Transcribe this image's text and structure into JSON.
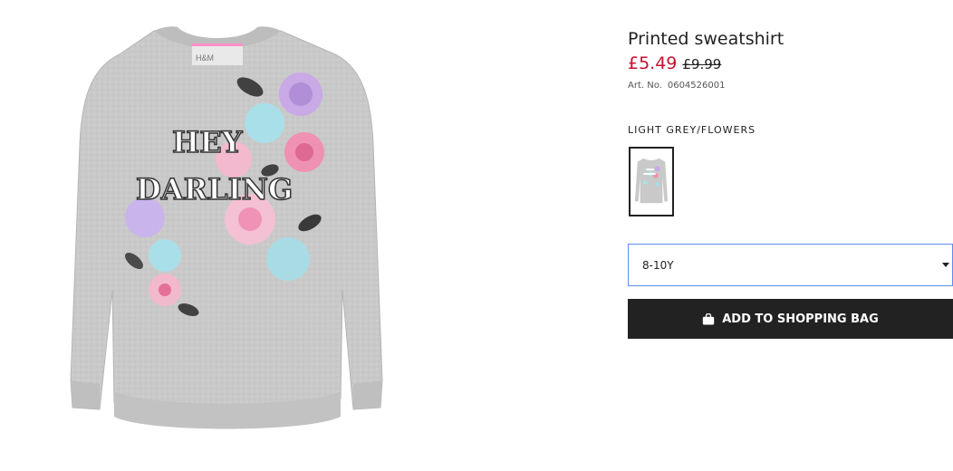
{
  "product": {
    "title": "Printed sweatshirt",
    "price_sale": "£5.49",
    "price_original": "£9.99",
    "art_label": "Art. No.",
    "art_number": "0604526001",
    "image_print_text_line1": "HEY",
    "image_print_text_line2": "DARLING",
    "image_neck_label": "H&M"
  },
  "color": {
    "name": "LIGHT GREY/FLOWERS",
    "selected_swatch": "light-grey-flowers"
  },
  "size_select": {
    "value": "8-10Y"
  },
  "actions": {
    "add_to_bag_label": "ADD TO SHOPPING BAG",
    "add_to_bag_icon": "shopping-bag-icon"
  },
  "colors": {
    "sale_red": "#c8102e",
    "button_black": "#222222",
    "select_border": "#5b8def",
    "sweatshirt_grey": "#c8c8c8"
  }
}
